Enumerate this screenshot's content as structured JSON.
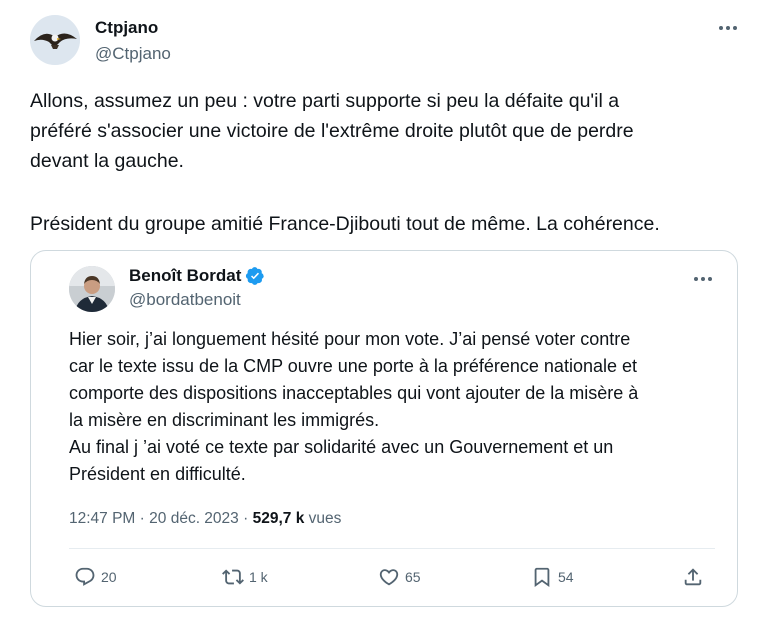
{
  "tweet": {
    "author_name": "Ctpjano",
    "author_handle": "@Ctpjano",
    "lines": [
      "Allons, assumez un peu : votre parti supporte si peu la défaite qu'il a",
      "préféré s'associer une victoire de l'extrême droite plutôt que de perdre",
      "devant la gauche.",
      "Président du groupe amitié France-Djibouti tout de même. La cohérence."
    ]
  },
  "quote": {
    "author_name": "Benoît Bordat",
    "author_handle": "@bordatbenoit",
    "verified": true,
    "lines": [
      "Hier soir, j’ai longuement hésité pour mon vote. J’ai pensé voter contre",
      "car le texte issu de la CMP ouvre une porte à la préférence nationale et",
      "comporte des dispositions inacceptables qui vont ajouter de la misère à",
      "la misère en discriminant les immigrés.",
      "Au final j ’ai voté ce texte par solidarité avec un Gouvernement et un",
      "Président en difficulté."
    ],
    "time": "12:47 PM",
    "separator": "·",
    "date": "20 déc. 2023",
    "views_count": "529,7 k",
    "views_label": "vues",
    "actions": {
      "replies": "20",
      "retweets": "1 k",
      "likes": "65",
      "bookmarks": "54"
    }
  },
  "colors": {
    "text": "#0f1419",
    "secondary": "#536471",
    "border": "#cfd9de",
    "verified": "#1d9bf0"
  }
}
